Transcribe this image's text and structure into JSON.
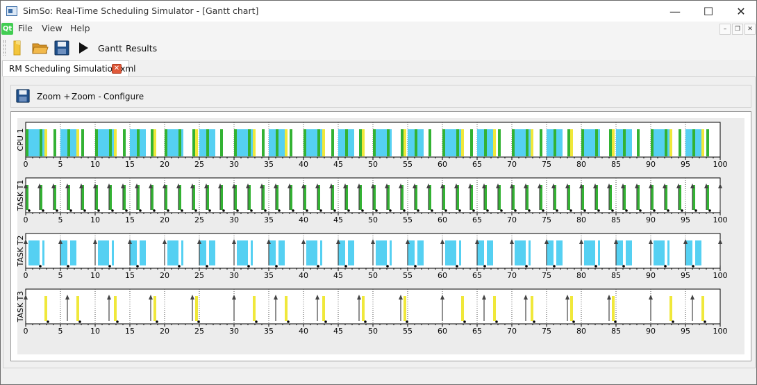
{
  "window": {
    "title": "SimSo: Real-Time Scheduling Simulator - [Gantt chart]",
    "minimize": "—",
    "maximize": "☐",
    "close": "✕"
  },
  "menubar": {
    "logo": "Qt",
    "items": [
      "File",
      "View",
      "Help"
    ],
    "mdi_minimize": "–",
    "mdi_restore": "❐",
    "mdi_close": "✕"
  },
  "toolbar": {
    "gantt_label": "Gantt",
    "results_label": "Results"
  },
  "tabs": [
    {
      "label": "RM Scheduling Simulation.xml",
      "close": "✕"
    }
  ],
  "gantt_toolbar": {
    "zoom_in_label": "Zoom +",
    "zoom_out_label": "Zoom -",
    "configure_label": "Configure"
  },
  "colors": {
    "task1": "#33b233",
    "task2": "#55d0f2",
    "task3": "#f0e83a",
    "arrow": "#444444",
    "deadline_dot": "#000000"
  },
  "chart_data": {
    "type": "gantt",
    "x_range": [
      0,
      100
    ],
    "x_ticks": [
      0,
      5,
      10,
      15,
      20,
      25,
      30,
      35,
      40,
      45,
      50,
      55,
      60,
      65,
      70,
      75,
      80,
      85,
      90,
      95,
      100
    ],
    "rows": [
      {
        "label": "CPU 1"
      },
      {
        "label": "TASK T1"
      },
      {
        "label": "TASK T2"
      },
      {
        "label": "TASK T3"
      }
    ],
    "tasks": {
      "T1": {
        "period": 2,
        "wcet": 0.4,
        "color_key": "task1"
      },
      "T2": {
        "period": 5,
        "wcet": 1.9,
        "color_key": "task2"
      },
      "T3": {
        "period": 6,
        "wcet": 0.4,
        "color_key": "task3"
      }
    }
  }
}
